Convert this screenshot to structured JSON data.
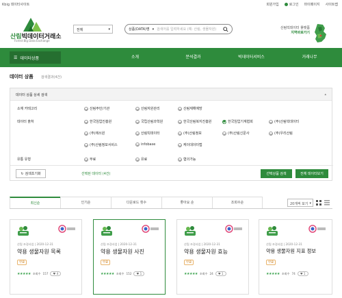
{
  "topbar": {
    "left_text": "Kbig 데이터사이트",
    "links": [
      "회원가입",
      "로그인",
      "마이페이지",
      "사이트맵"
    ]
  },
  "header": {
    "logo_prefix": "산림",
    "logo_main": "빅데이터거래소",
    "logo_sub": "Forest Big Data Exchange",
    "select_value": "전체",
    "search_category": "상품(DATA)명",
    "search_placeholder": "검색어를 입력하세요 (예: 산림, 생물자원)",
    "region_line1": "산림빅데이터 플랫폼",
    "region_line2": "지역바로가기"
  },
  "nav": {
    "home_label": "데이터상품",
    "items": [
      "소개",
      "분석결과",
      "빅데이터서비스",
      "거래나무"
    ]
  },
  "page": {
    "title": "데이터 상품",
    "count": "검색결과(4건)"
  },
  "filter": {
    "header": "데이터 상품 상세 검색",
    "rows": [
      {
        "label": "소재 카테고리",
        "options": [
          {
            "text": "산림주민/기관",
            "on": false
          },
          {
            "text": "산림자원관리",
            "on": false
          },
          {
            "text": "산림재해예방",
            "on": false
          }
        ]
      },
      {
        "label": "데이터 출처",
        "options": [
          {
            "text": "한국임업진흥원",
            "on": false
          },
          {
            "text": "국립산림과학원",
            "on": false
          },
          {
            "text": "한국산림복지진흥원",
            "on": false
          },
          {
            "text": "한국임업기계협회",
            "on": true
          },
          {
            "text": "(주)산림빅데이터",
            "on": false
          },
          {
            "text": "(주)에쓰원",
            "on": false
          },
          {
            "text": "산림빅데이터",
            "on": false
          },
          {
            "text": "(주)산림정보",
            "on": false
          },
          {
            "text": "(주)산림신문사",
            "on": false
          },
          {
            "text": "(주)우리산림",
            "on": false
          },
          {
            "text": "(주)산림정보서비스",
            "on": false
          },
          {
            "text": "infobase",
            "on": false
          },
          {
            "text": "케이데이터랩",
            "on": false
          }
        ]
      },
      {
        "label": "유통 유형",
        "options": [
          {
            "text": "무료",
            "on": false
          },
          {
            "text": "유료",
            "on": false
          },
          {
            "text": "협의가능",
            "on": false
          }
        ]
      }
    ],
    "reset_label": "검색초기화",
    "selected_info": "선택된 데이터 (4건)",
    "btn_search": "선택상품 검색",
    "btn_all": "전체 데이터보기"
  },
  "sort": {
    "tabs": [
      "최신순",
      "인기순",
      "다운로드 횟수",
      "좋아요 순",
      "조회수순"
    ],
    "active_index": 0,
    "per_page": "20개씩 보기"
  },
  "cards": [
    {
      "org": "산림 조경사업 | 2020-12-31",
      "title": "약용 생물자원 목록",
      "fee": "무료",
      "score": "조회수",
      "views": "157",
      "likes": "4"
    },
    {
      "org": "산림 조경사업 | 2020-12-31",
      "title": "약용 생물자원 사진",
      "fee": "무료",
      "score": "조회수",
      "views": "152",
      "likes": "1"
    },
    {
      "org": "산림 조경사업 | 2020-12-31",
      "title": "약용 생물자원 효능",
      "fee": "무료",
      "score": "조회수",
      "views": "24",
      "likes": "1"
    },
    {
      "org": "산림 조경사업 | 2020-12-31",
      "title": "약용 생물자원 지표 정보",
      "fee": "무료",
      "score": "조회수",
      "views": "74",
      "likes": "1"
    }
  ],
  "colors": {
    "accent": "#2e8b3c",
    "nav_dark": "#256f30",
    "fee": "#c87a15"
  }
}
